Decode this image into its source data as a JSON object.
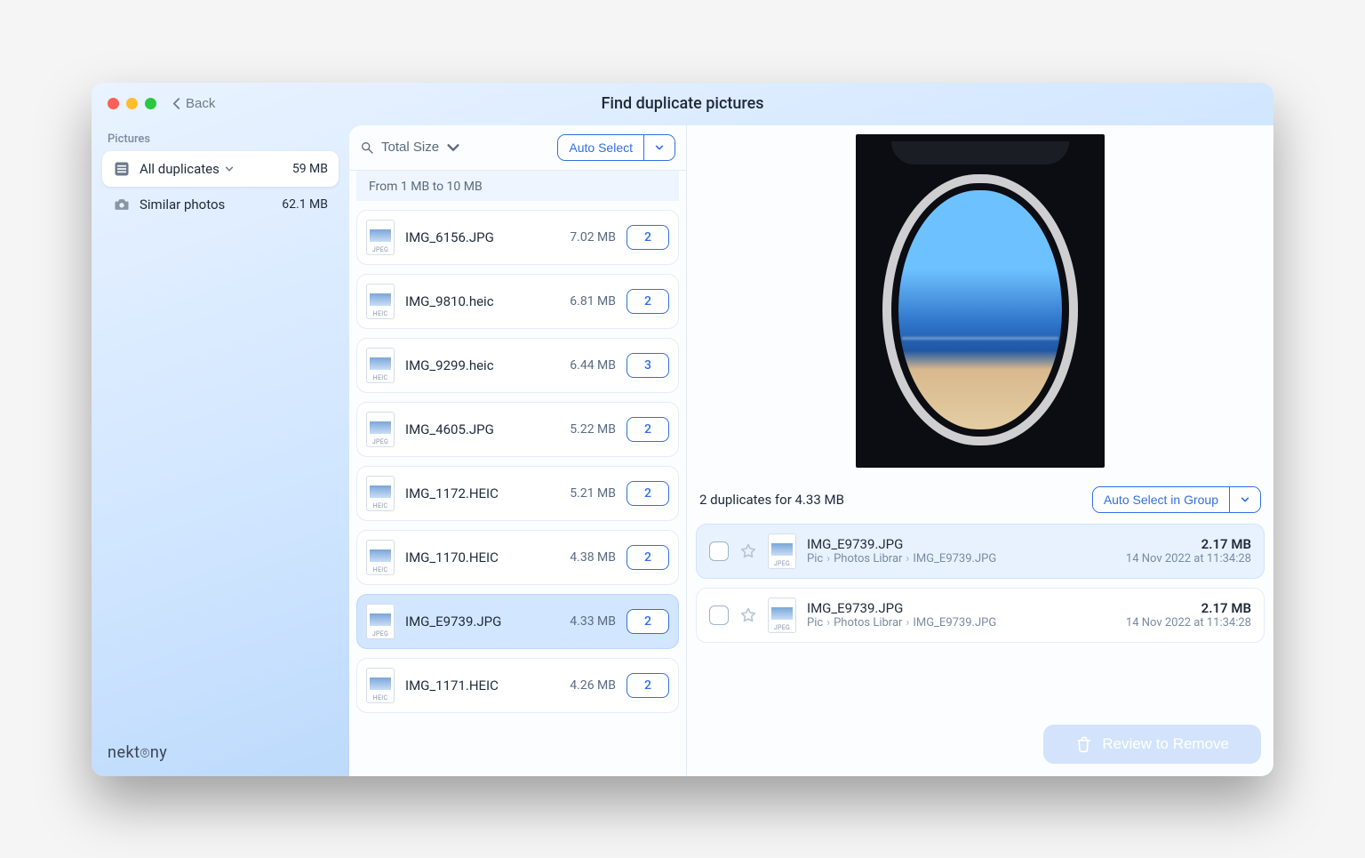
{
  "header": {
    "back_label": "Back",
    "title": "Find duplicate pictures"
  },
  "sidebar": {
    "heading": "Pictures",
    "items": [
      {
        "id": "all-duplicates",
        "label": "All duplicates",
        "size": "59 MB",
        "has_chevron": true
      },
      {
        "id": "similar-photos",
        "label": "Similar photos",
        "size": "62.1 MB",
        "has_chevron": false
      }
    ]
  },
  "brand": "nektony",
  "list": {
    "sort_label": "Total Size",
    "auto_select_label": "Auto Select",
    "group_header": "From 1 MB to 10 MB",
    "rows": [
      {
        "name": "IMG_6156.JPG",
        "ext": "JPEG",
        "size": "7.02 MB",
        "count": "2"
      },
      {
        "name": "IMG_9810.heic",
        "ext": "HEIC",
        "size": "6.81 MB",
        "count": "2"
      },
      {
        "name": "IMG_9299.heic",
        "ext": "HEIC",
        "size": "6.44 MB",
        "count": "3"
      },
      {
        "name": "IMG_4605.JPG",
        "ext": "JPEG",
        "size": "5.22 MB",
        "count": "2"
      },
      {
        "name": "IMG_1172.HEIC",
        "ext": "HEIC",
        "size": "5.21 MB",
        "count": "2"
      },
      {
        "name": "IMG_1170.HEIC",
        "ext": "HEIC",
        "size": "4.38 MB",
        "count": "2"
      },
      {
        "name": "IMG_E9739.JPG",
        "ext": "JPEG",
        "size": "4.33 MB",
        "count": "2"
      },
      {
        "name": "IMG_1171.HEIC",
        "ext": "HEIC",
        "size": "4.26 MB",
        "count": "2"
      }
    ],
    "selected_index": 6
  },
  "preview": {
    "summary": "2 duplicates for 4.33 MB",
    "auto_select_group_label": "Auto Select in Group",
    "duplicates": [
      {
        "name": "IMG_E9739.JPG",
        "ext": "JPEG",
        "path_segments": [
          "Pic",
          "Photos Librar",
          "IMG_E9739.JPG"
        ],
        "size": "2.17 MB",
        "date": "14 Nov 2022 at 11:34:28"
      },
      {
        "name": "IMG_E9739.JPG",
        "ext": "JPEG",
        "path_segments": [
          "Pic",
          "Photos Librar",
          "IMG_E9739.JPG"
        ],
        "size": "2.17 MB",
        "date": "14 Nov 2022 at 11:34:28"
      }
    ],
    "selected_dup_index": 0
  },
  "actions": {
    "review_label": "Review to Remove"
  }
}
